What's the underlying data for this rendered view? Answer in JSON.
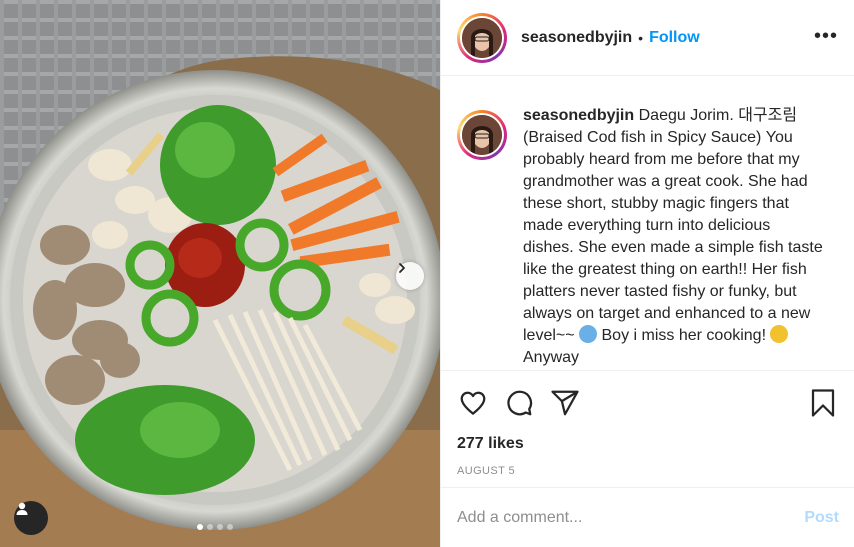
{
  "post": {
    "username": "seasonedbyjin",
    "follow_label": "Follow",
    "separator": "•",
    "more_label": "•••",
    "caption_text": "Daegu Jorim. 대구조림 (Braised Cod fish in Spicy Sauce) You probably heard from me before that my grandmother was a great cook. She had these short, stubby magic fingers that made everything turn into delicious dishes. She even made a simple fish taste like the greatest thing on earth!! Her fish platters never tasted fishy or funky, but always on target and enhanced to a new level~~",
    "caption_tail_1": "Boy i miss her cooking!",
    "caption_tail_2": "Anyway",
    "likes": "277 likes",
    "date": "AUGUST 5",
    "comment_placeholder": "Add a comment...",
    "post_label": "Post",
    "carousel": {
      "count": 4,
      "active_index": 0
    }
  },
  "colors": {
    "link_blue": "#0095f6",
    "post_disabled": "#b3dbff",
    "border": "#efefef",
    "muted": "#8e8e8e"
  },
  "icons": {
    "like": "heart-icon",
    "comment": "comment-icon",
    "share": "share-icon",
    "save": "bookmark-icon",
    "next": "chevron-right-icon",
    "tag": "user-tag-icon",
    "more": "more-options-icon"
  }
}
